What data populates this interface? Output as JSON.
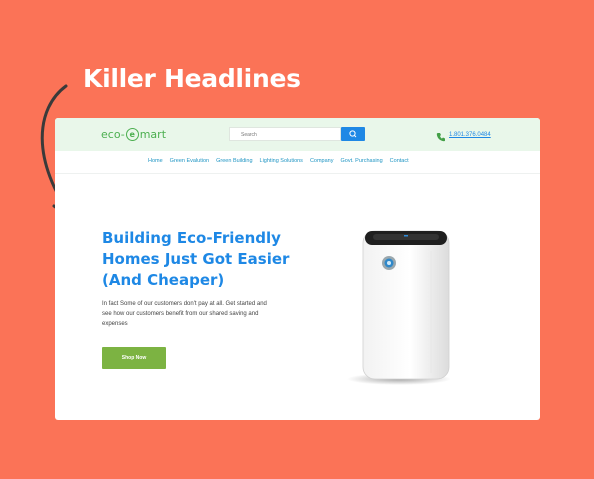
{
  "caption": {
    "title": "Killer Headlines"
  },
  "header": {
    "logo_prefix": "eco-",
    "logo_mark": "e",
    "logo_suffix": "mart",
    "search_placeholder": "Search",
    "phone": "1.801.376.0484"
  },
  "nav": {
    "items": [
      "Home",
      "Green Evalution",
      "Green Building",
      "Lighting Solutions",
      "Company",
      "Govt. Purchasing",
      "Contact"
    ]
  },
  "hero": {
    "title": "Building Eco-Friendly Homes Just Got Easier (And Cheaper)",
    "body": "In fact Some of our customers don't pay at all. Get started and see how our customers benefit from our shared saving and expenses",
    "cta": "Shop Now"
  },
  "colors": {
    "background": "#fb7357",
    "accent": "#1e88e5",
    "cta": "#7cb342",
    "header": "#e9f7ea"
  }
}
